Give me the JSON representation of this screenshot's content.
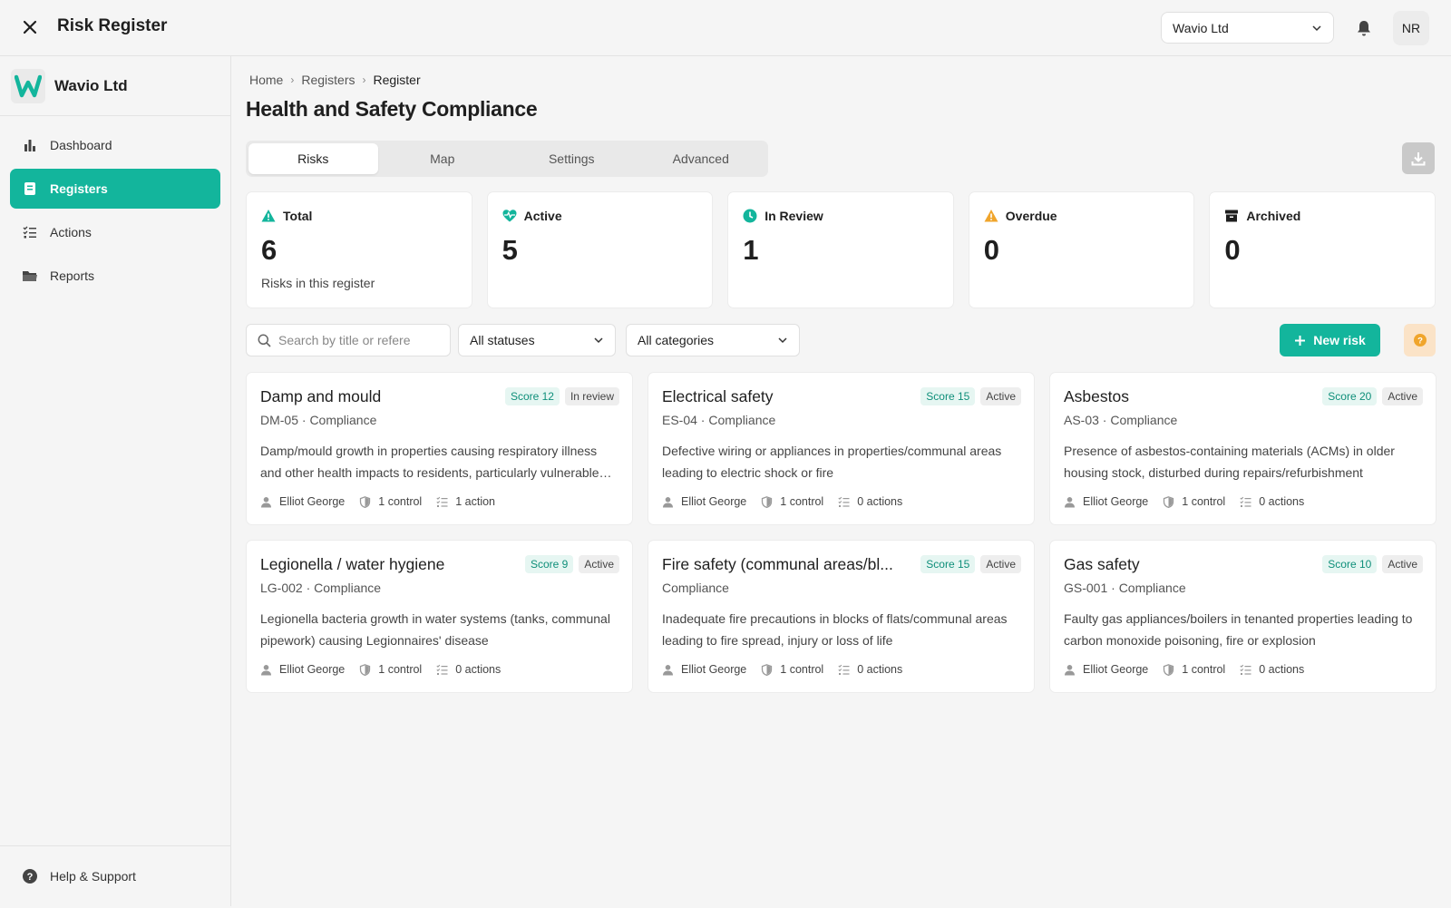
{
  "app": {
    "title": "Risk Register"
  },
  "header": {
    "org_select": "Wavio Ltd",
    "avatar_initials": "NR"
  },
  "sidebar": {
    "org_name": "Wavio Ltd",
    "items": [
      {
        "label": "Dashboard",
        "icon": "bar-chart-icon"
      },
      {
        "label": "Registers",
        "icon": "book-icon"
      },
      {
        "label": "Actions",
        "icon": "checklist-icon"
      },
      {
        "label": "Reports",
        "icon": "folder-icon"
      }
    ],
    "help": "Help & Support"
  },
  "breadcrumb": {
    "home": "Home",
    "registers": "Registers",
    "current": "Register"
  },
  "page": {
    "title": "Health and Safety Compliance"
  },
  "tabs": [
    "Risks",
    "Map",
    "Settings",
    "Advanced"
  ],
  "stats": [
    {
      "label": "Total",
      "value": "6",
      "sub": "Risks in this register",
      "icon": "warning-triangle-icon",
      "color": "#13b59c"
    },
    {
      "label": "Active",
      "value": "5",
      "sub": "",
      "icon": "heartbeat-icon",
      "color": "#13b59c"
    },
    {
      "label": "In Review",
      "value": "1",
      "sub": "",
      "icon": "clock-icon",
      "color": "#13b59c"
    },
    {
      "label": "Overdue",
      "value": "0",
      "sub": "",
      "icon": "alert-triangle-icon",
      "color": "#f0a52c"
    },
    {
      "label": "Archived",
      "value": "0",
      "sub": "",
      "icon": "archive-box-icon",
      "color": "#1f1f1f"
    }
  ],
  "filters": {
    "search_placeholder": "Search by title or refere",
    "status": "All statuses",
    "category": "All categories",
    "new_risk": "New risk"
  },
  "risks": [
    {
      "title": "Damp and mould",
      "score": "Score 12",
      "status": "In review",
      "ref": "DM-05 · Compliance",
      "desc": "Damp/mould growth in properties causing respiratory illness and other health impacts to residents, particularly vulnerable residents",
      "owner": "Elliot George",
      "controls": "1 control",
      "actions": "1 action"
    },
    {
      "title": "Electrical safety",
      "score": "Score 15",
      "status": "Active",
      "ref": "ES-04 · Compliance",
      "desc": "Defective wiring or appliances in properties/communal areas leading to electric shock or fire",
      "owner": "Elliot George",
      "controls": "1 control",
      "actions": "0 actions"
    },
    {
      "title": "Asbestos",
      "score": "Score 20",
      "status": "Active",
      "ref": "AS-03 · Compliance",
      "desc": "Presence of asbestos-containing materials (ACMs) in older housing stock, disturbed during repairs/refurbishment",
      "owner": "Elliot George",
      "controls": "1 control",
      "actions": "0 actions"
    },
    {
      "title": "Legionella / water hygiene",
      "score": "Score 9",
      "status": "Active",
      "ref": "LG-002 · Compliance",
      "desc": "Legionella bacteria growth in water systems (tanks, communal pipework) causing Legionnaires' disease",
      "owner": "Elliot George",
      "controls": "1 control",
      "actions": "0 actions"
    },
    {
      "title": "Fire safety (communal areas/bl...",
      "score": "Score 15",
      "status": "Active",
      "ref": "Compliance",
      "desc": "Inadequate fire precautions in blocks of flats/communal areas leading to fire spread, injury or loss of life",
      "owner": "Elliot George",
      "controls": "1 control",
      "actions": "0 actions"
    },
    {
      "title": "Gas safety",
      "score": "Score 10",
      "status": "Active",
      "ref": "GS-001 · Compliance",
      "desc": "Faulty gas appliances/boilers in tenanted properties leading to carbon monoxide poisoning, fire or explosion",
      "owner": "Elliot George",
      "controls": "1 control",
      "actions": "0 actions"
    }
  ]
}
